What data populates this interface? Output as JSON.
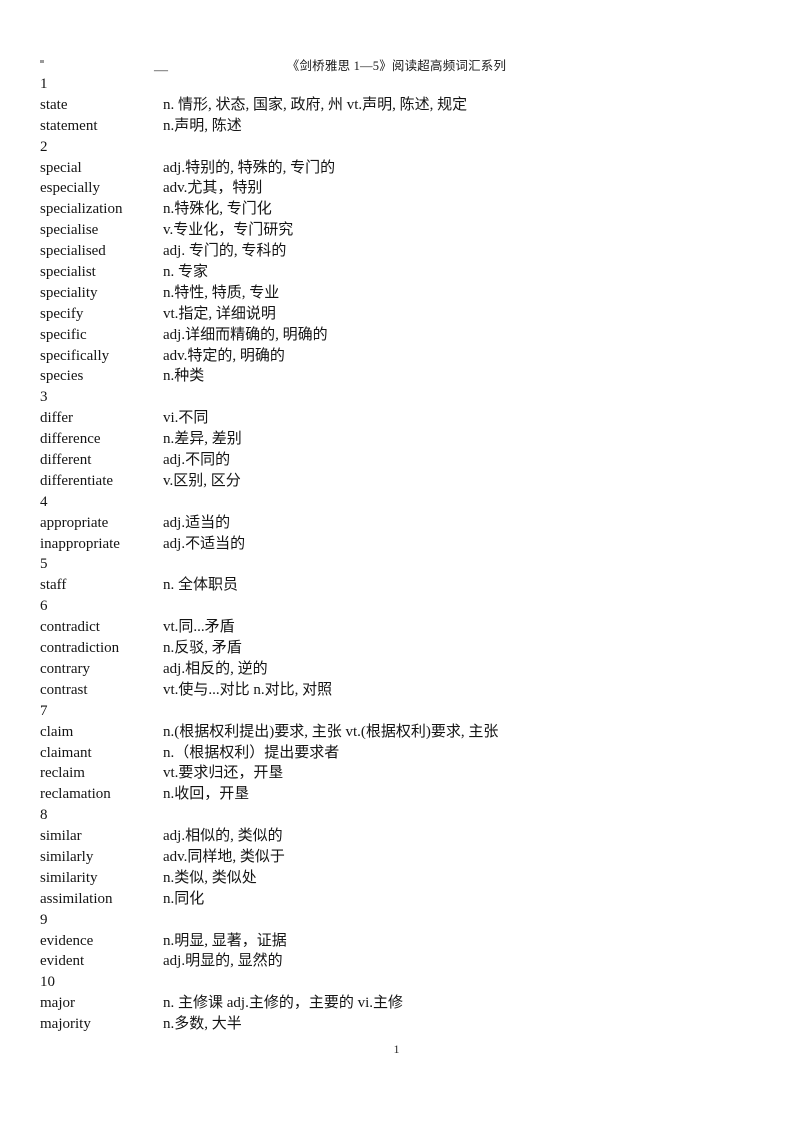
{
  "document": {
    "header_title": "《剑桥雅思 1—5》阅读超高频词汇系列",
    "header_dash": "—",
    "page_number": "1"
  },
  "entries": [
    {
      "kind": "group",
      "number": "1"
    },
    {
      "kind": "word",
      "term": "state",
      "definition": "n. 情形, 状态, 国家, 政府, 州     vt.声明, 陈述, 规定"
    },
    {
      "kind": "word",
      "term": "statement",
      "definition": "n.声明, 陈述"
    },
    {
      "kind": "group",
      "number": "2"
    },
    {
      "kind": "word",
      "term": "special",
      "definition": "adj.特别的, 特殊的, 专门的"
    },
    {
      "kind": "word",
      "term": "especially",
      "definition": "adv.尤其，特别"
    },
    {
      "kind": "word",
      "term": "specialization",
      "definition": "n.特殊化, 专门化"
    },
    {
      "kind": "word",
      "term": "specialise",
      "definition": "v.专业化，专门研究"
    },
    {
      "kind": "word",
      "term": "specialised",
      "definition": "adj. 专门的, 专科的"
    },
    {
      "kind": "word",
      "term": "specialist",
      "definition": "n. 专家"
    },
    {
      "kind": "word",
      "term": "speciality",
      "definition": "n.特性, 特质, 专业"
    },
    {
      "kind": "word",
      "term": "specify",
      "definition": "vt.指定, 详细说明"
    },
    {
      "kind": "word",
      "term": "specific",
      "definition": "adj.详细而精确的, 明确的"
    },
    {
      "kind": "word",
      "term": "specifically",
      "definition": "adv.特定的, 明确的"
    },
    {
      "kind": "word",
      "term": "species",
      "definition": "n.种类"
    },
    {
      "kind": "group",
      "number": "3"
    },
    {
      "kind": "word",
      "term": "differ",
      "definition": "vi.不同"
    },
    {
      "kind": "word",
      "term": "difference",
      "definition": "n.差异, 差别"
    },
    {
      "kind": "word",
      "term": "different",
      "definition": "adj.不同的"
    },
    {
      "kind": "word",
      "term": "differentiate",
      "definition": "v.区别, 区分"
    },
    {
      "kind": "group",
      "number": "4"
    },
    {
      "kind": "word",
      "term": "appropriate",
      "definition": "adj.适当的"
    },
    {
      "kind": "word",
      "term": "inappropriate",
      "definition": "adj.不适当的"
    },
    {
      "kind": "group",
      "number": "5"
    },
    {
      "kind": "word",
      "term": "staff",
      "definition": "n. 全体职员"
    },
    {
      "kind": "group",
      "number": "6"
    },
    {
      "kind": "word",
      "term": "contradict",
      "definition": "vt.同...矛盾"
    },
    {
      "kind": "word",
      "term": "contradiction",
      "definition": "n.反驳, 矛盾"
    },
    {
      "kind": "word",
      "term": "contrary",
      "definition": "adj.相反的, 逆的"
    },
    {
      "kind": "word",
      "term": "contrast",
      "definition": "vt.使与...对比   n.对比, 对照"
    },
    {
      "kind": "group",
      "number": "7"
    },
    {
      "kind": "word",
      "term": "claim",
      "definition": "n.(根据权利提出)要求, 主张   vt.(根据权利)要求, 主张"
    },
    {
      "kind": "word",
      "term": "claimant",
      "definition": "n.（根据权利）提出要求者"
    },
    {
      "kind": "word",
      "term": "reclaim",
      "definition": "vt.要求归还，开垦"
    },
    {
      "kind": "word",
      "term": "reclamation",
      "definition": "n.收回，开垦"
    },
    {
      "kind": "group",
      "number": "8"
    },
    {
      "kind": "word",
      "term": "similar",
      "definition": "adj.相似的, 类似的"
    },
    {
      "kind": "word",
      "term": "similarly",
      "definition": "adv.同样地, 类似于"
    },
    {
      "kind": "word",
      "term": "similarity",
      "definition": "n.类似, 类似处"
    },
    {
      "kind": "word",
      "term": "assimilation",
      "definition": "n.同化"
    },
    {
      "kind": "group",
      "number": "9"
    },
    {
      "kind": "word",
      "term": "evidence",
      "definition": "n.明显, 显著，证据"
    },
    {
      "kind": "word",
      "term": "evident",
      "definition": "adj.明显的, 显然的"
    },
    {
      "kind": "group",
      "number": "10"
    },
    {
      "kind": "word",
      "term": "major",
      "definition": "n. 主修课   adj.主修的，主要的   vi.主修"
    },
    {
      "kind": "word",
      "term": "majority",
      "definition": "n.多数, 大半"
    }
  ]
}
